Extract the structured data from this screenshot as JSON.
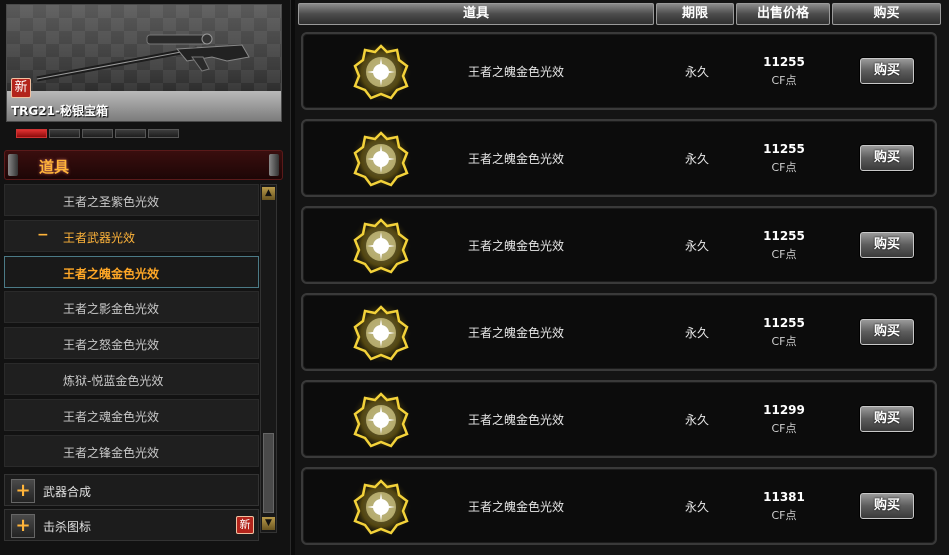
{
  "preview": {
    "item_name": "TRG21-秘银宝箱",
    "new_badge": "新",
    "pager_count": 5,
    "pager_active": 1
  },
  "category": {
    "title": "道具"
  },
  "sidebar": {
    "items": [
      {
        "label": "王者之圣紫色光效"
      },
      {
        "label": "王者武器光效",
        "group": true,
        "toggle": "−"
      },
      {
        "label": "王者之魄金色光效",
        "selected": true
      },
      {
        "label": "王者之影金色光效"
      },
      {
        "label": "王者之怒金色光效"
      },
      {
        "label": "炼狱-悦蓝金色光效"
      },
      {
        "label": "王者之魂金色光效"
      },
      {
        "label": "王者之锋金色光效"
      }
    ],
    "categories": [
      {
        "label": "武器合成",
        "toggle": "+"
      },
      {
        "label": "击杀图标",
        "toggle": "+",
        "badge": "新"
      }
    ],
    "scroll_up": "▲",
    "scroll_down": "▼"
  },
  "table": {
    "headers": [
      "道具",
      "期限",
      "出售价格",
      "购买"
    ],
    "rows": [
      {
        "name": "王者之魄金色光效",
        "period": "永久",
        "price": "11255",
        "unit": "CF点",
        "buy": "购买",
        "icon": "gold-aura-icon"
      },
      {
        "name": "王者之魄金色光效",
        "period": "永久",
        "price": "11255",
        "unit": "CF点",
        "buy": "购买",
        "icon": "gold-aura-icon"
      },
      {
        "name": "王者之魄金色光效",
        "period": "永久",
        "price": "11255",
        "unit": "CF点",
        "buy": "购买",
        "icon": "gold-aura-icon"
      },
      {
        "name": "王者之魄金色光效",
        "period": "永久",
        "price": "11255",
        "unit": "CF点",
        "buy": "购买",
        "icon": "gold-aura-icon"
      },
      {
        "name": "王者之魄金色光效",
        "period": "永久",
        "price": "11299",
        "unit": "CF点",
        "buy": "购买",
        "icon": "gold-aura-icon"
      },
      {
        "name": "王者之魄金色光效",
        "period": "永久",
        "price": "11381",
        "unit": "CF点",
        "buy": "购买",
        "icon": "gold-aura-icon"
      }
    ]
  },
  "colors": {
    "accent": "#ffb43a",
    "selected_text": "#ffa726",
    "badge": "#b3241b"
  }
}
